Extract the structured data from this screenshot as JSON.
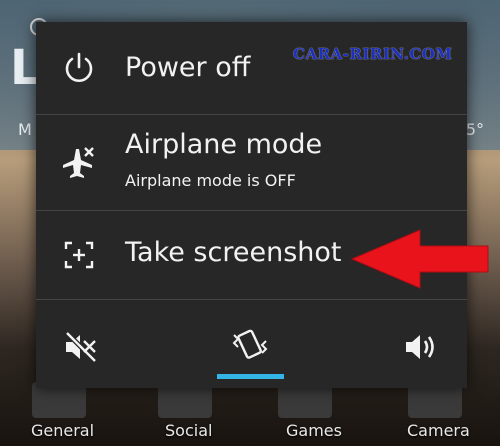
{
  "background": {
    "widget_letter": "L",
    "widget_left_text": "M",
    "widget_right_text": "5°",
    "dock": [
      {
        "label": "General"
      },
      {
        "label": "Social"
      },
      {
        "label": "Games"
      },
      {
        "label": "Camera"
      }
    ]
  },
  "watermark": "CARA-RIRIN.COM",
  "menu": {
    "power_off": {
      "label": "Power off",
      "icon": "power-icon"
    },
    "airplane": {
      "label": "Airplane mode",
      "status": "Airplane mode is OFF",
      "icon": "airplane-icon"
    },
    "screenshot": {
      "label": "Take screenshot",
      "icon": "screenshot-icon"
    }
  },
  "sound_modes": {
    "items": [
      "silent-icon",
      "vibrate-icon",
      "sound-on-icon"
    ],
    "selected": "vibrate",
    "accent_color": "#33b5e5"
  },
  "annotation": {
    "arrow_color": "#e8131b"
  }
}
